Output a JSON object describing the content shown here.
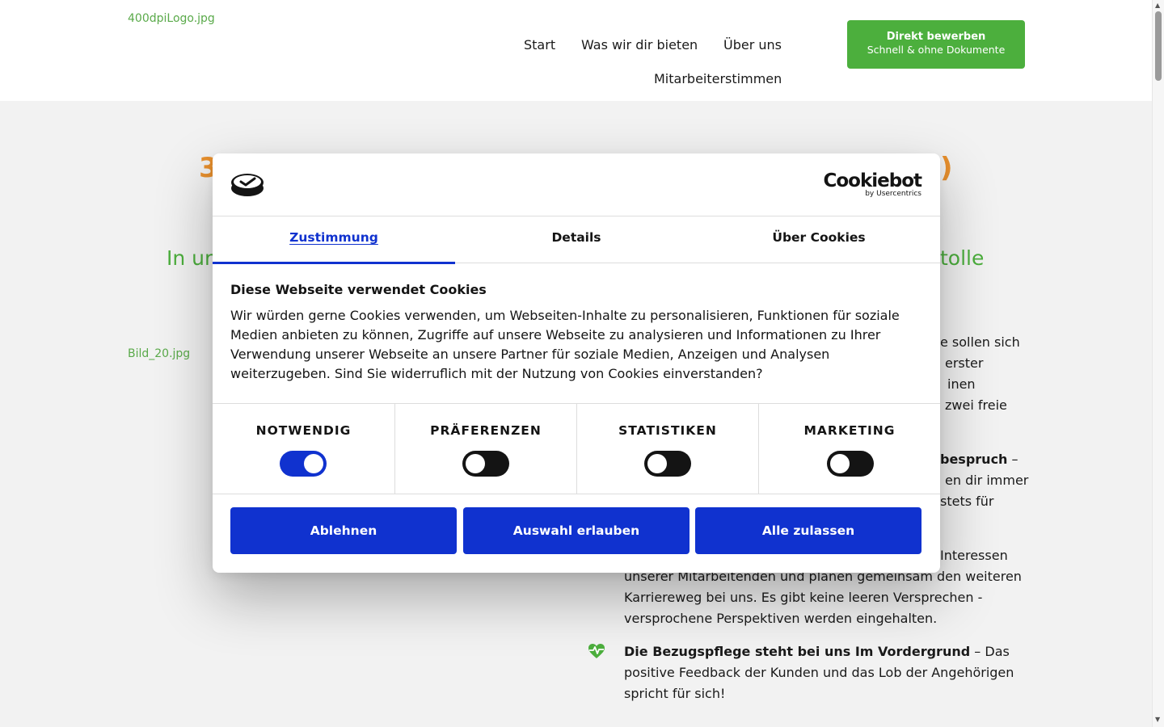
{
  "header": {
    "logo_alt": "400dpiLogo.jpg",
    "nav": [
      "Start",
      "Was wir dir bieten",
      "Über uns",
      "Mitarbeiterstimmen"
    ],
    "cta_line1": "Direkt bewerben",
    "cta_line2": "Schnell & ohne Dokumente"
  },
  "main": {
    "headline_left": "3",
    "headline_right": ")",
    "subline_left": "In ur",
    "subline_right": "tolle",
    "image_alt": "Bild_20.jpg",
    "para1_fragments": [
      "e sollen sich",
      "erster",
      "inen",
      "zwei freie"
    ],
    "para2_bold_fragment": "bespruch",
    "para2_fragments": [
      "en dir immer",
      "stets für"
    ],
    "para3_fragment": "Interessen",
    "para3_lines": [
      "unserer Mitarbeitenden und planen gemeinsam den weiteren",
      "Karriereweg bei uns. Es gibt keine leeren Versprechen -",
      "versprochene Perspektiven werden eingehalten."
    ],
    "para4_bold": "Die Bezugspflege steht bei uns Im Vordergrund",
    "para4_rest": "– Das",
    "para4_lines": [
      "positive Feedback der Kunden und das Lob der Angehörigen",
      "spricht für sich!"
    ]
  },
  "cookie_dialog": {
    "brand": "Cookiebot",
    "brand_sub": "by Usercentrics",
    "tabs": [
      "Zustimmung",
      "Details",
      "Über Cookies"
    ],
    "active_tab": "Zustimmung",
    "title": "Diese Webseite verwendet Cookies",
    "text": "Wir würden gerne Cookies verwenden, um Webseiten-Inhalte zu personalisieren, Funktionen für soziale Medien anbieten zu können, Zugriffe auf unsere Webseite zu analysieren und Informationen zu Ihrer Verwendung unserer Webseite an unsere Partner für soziale Medien, Anzeigen und Analysen weiterzugeben. Sind Sie widerruflich mit der Nutzung von Cookies einverstanden?",
    "categories": [
      {
        "label": "NOTWENDIG",
        "enabled": true
      },
      {
        "label": "PRÄFERENZEN",
        "enabled": false
      },
      {
        "label": "STATISTIKEN",
        "enabled": false
      },
      {
        "label": "MARKETING",
        "enabled": false
      }
    ],
    "buttons": [
      "Ablehnen",
      "Auswahl erlauben",
      "Alle zulassen"
    ]
  },
  "colors": {
    "accent_blue": "#1032cf",
    "green": "#4caf3d",
    "orange": "#e8902e"
  }
}
